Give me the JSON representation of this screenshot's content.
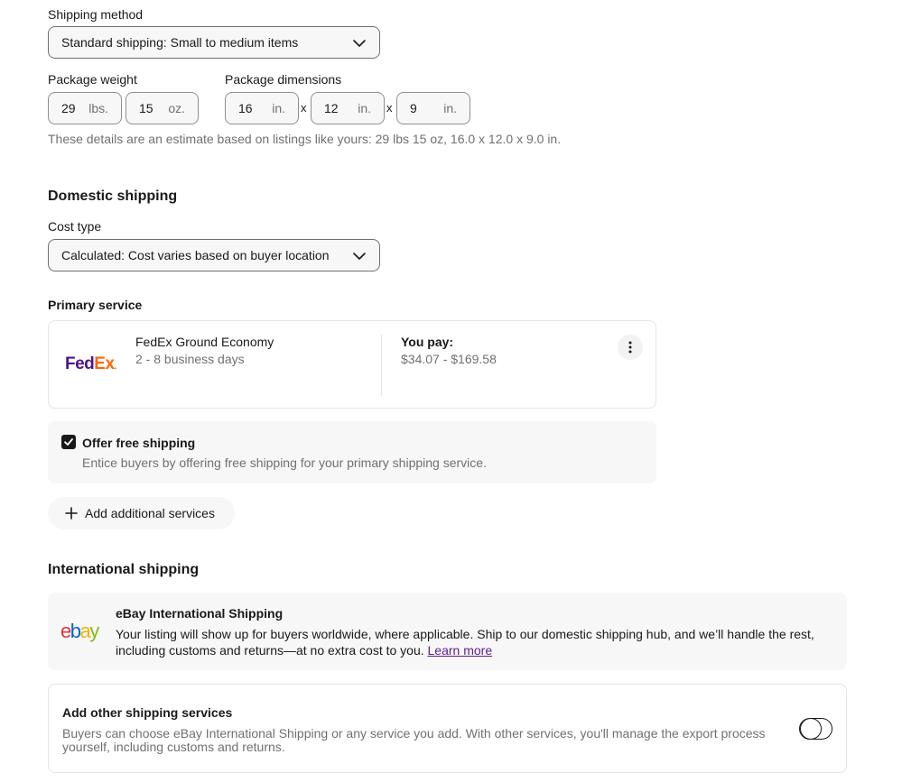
{
  "shipping_method": {
    "label": "Shipping method",
    "selected": "Standard shipping: Small to medium items"
  },
  "package_weight": {
    "label": "Package weight",
    "lbs_value": "29",
    "lbs_unit": "lbs.",
    "oz_value": "15",
    "oz_unit": "oz."
  },
  "package_dimensions": {
    "label": "Package dimensions",
    "length": "16",
    "width": "12",
    "height": "9",
    "unit": "in.",
    "separator": "x"
  },
  "estimate_note": "These details are an estimate based on listings like yours: 29 lbs 15 oz, 16.0 x 12.0 x 9.0 in.",
  "domestic": {
    "title": "Domestic shipping",
    "cost_type_label": "Cost type",
    "cost_type_selected": "Calculated: Cost varies based on buyer location",
    "primary_service_label": "Primary service",
    "carrier_logo_text_fed": "Fed",
    "carrier_logo_text_ex": "Ex",
    "service_name": "FedEx Ground Economy",
    "service_time": "2 - 8 business days",
    "you_pay_label": "You pay:",
    "you_pay_value": "$34.07 - $169.58",
    "free_shipping_label": "Offer free shipping",
    "free_shipping_desc": "Entice buyers by offering free shipping for your primary shipping service.",
    "free_shipping_checked": true,
    "add_services_label": "Add additional services"
  },
  "international": {
    "title": "International shipping",
    "ebay_logo_letters": [
      "e",
      "b",
      "a",
      "y"
    ],
    "ebay_logo_colors": [
      "#e53238",
      "#0064d2",
      "#f5af02",
      "#86b817"
    ],
    "program_title": "eBay International Shipping",
    "program_desc": "Your listing will show up for buyers worldwide, where applicable. Ship to our domestic shipping hub, and we’ll handle the rest, including customs and returns—at no extra cost to you.",
    "learn_more": "Learn more",
    "other_title": "Add other shipping services",
    "other_desc": "Buyers can choose eBay International Shipping or any service you add. With other services, you'll manage the export process yourself, including customs and returns.",
    "other_toggle_on": false
  },
  "colors": {
    "fedex_purple": "#4d148c",
    "fedex_orange": "#ff6600",
    "link_purple": "#5e1c8f",
    "muted_text": "#707070"
  }
}
